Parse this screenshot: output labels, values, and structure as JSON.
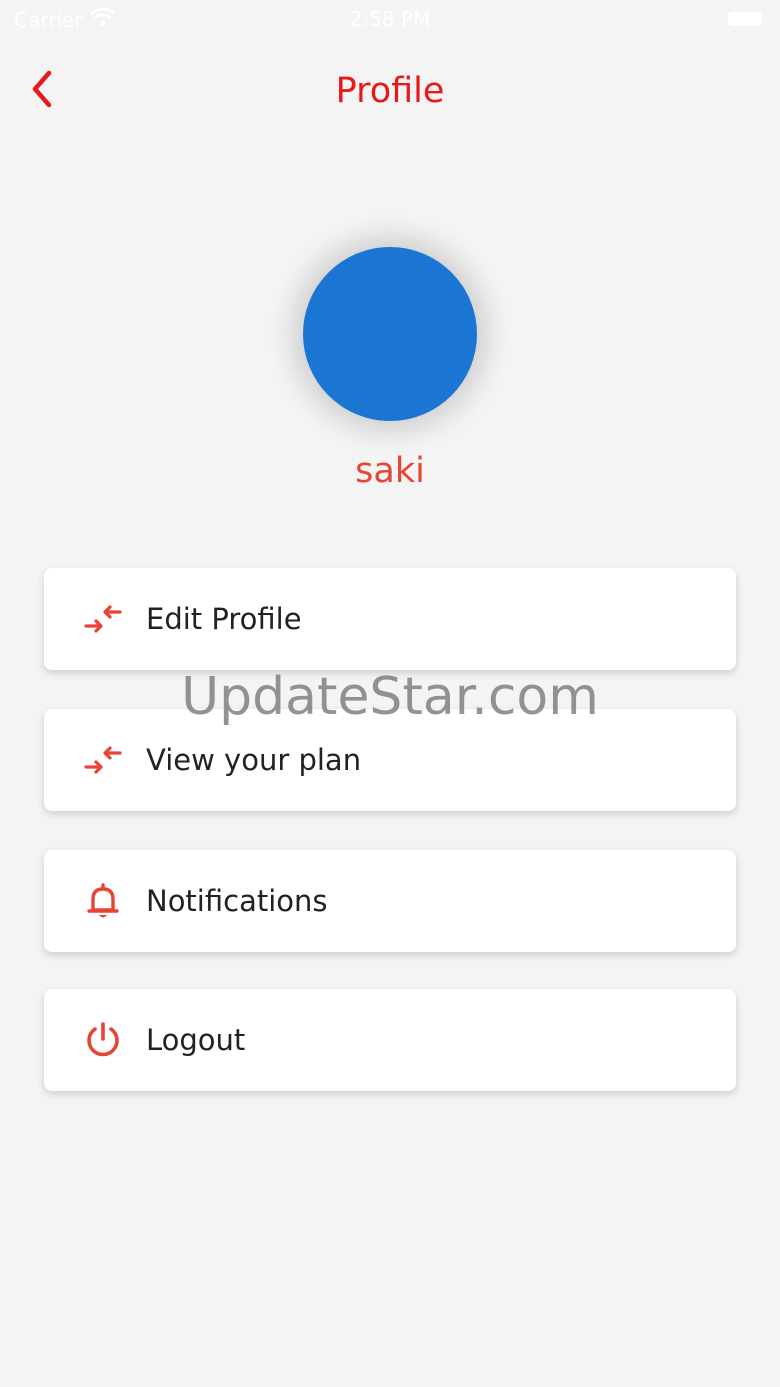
{
  "status_bar": {
    "carrier": "Carrier",
    "time": "2:58 PM"
  },
  "header": {
    "title": "Profile",
    "back_icon": "chevron-left-icon"
  },
  "profile": {
    "avatar_color": "#1a76d2",
    "name": "saki"
  },
  "menu": {
    "items": [
      {
        "label": "Edit Profile",
        "icon": "compare-arrows-icon"
      },
      {
        "label": "View your plan",
        "icon": "compare-arrows-icon"
      },
      {
        "label": "Notifications",
        "icon": "bell-icon"
      },
      {
        "label": "Logout",
        "icon": "power-icon"
      }
    ]
  },
  "watermark": "UpdateStar.com",
  "colors": {
    "accent": "#e8191b",
    "icon_red": "#e84434",
    "background": "#f4f4f4",
    "card": "#ffffff"
  }
}
